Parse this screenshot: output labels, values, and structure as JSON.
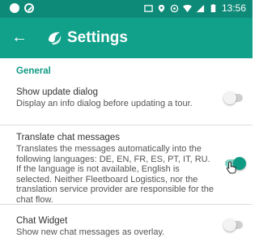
{
  "status_bar": {
    "time": "13:56"
  },
  "toolbar": {
    "title": "Settings"
  },
  "section": {
    "title": "General"
  },
  "settings": [
    {
      "title": "Show update dialog",
      "description": "Display an info dialog before updating a tour.",
      "enabled": false
    },
    {
      "title": "Translate chat messages",
      "description": "Translates the messages automatically into the following languages: DE, EN, FR, ES, PT, IT, RU. If the language is not available, English is selected. Neither Fleetboard Logistics, nor the translation service provider are responsible for the chat flow.",
      "enabled": true
    },
    {
      "title": "Chat Widget",
      "description": "Show new chat messages as overlay.",
      "enabled": false
    }
  ],
  "colors": {
    "status_bar": "#0e8a78",
    "toolbar": "#11a08a",
    "accent": "#0f9a84"
  }
}
